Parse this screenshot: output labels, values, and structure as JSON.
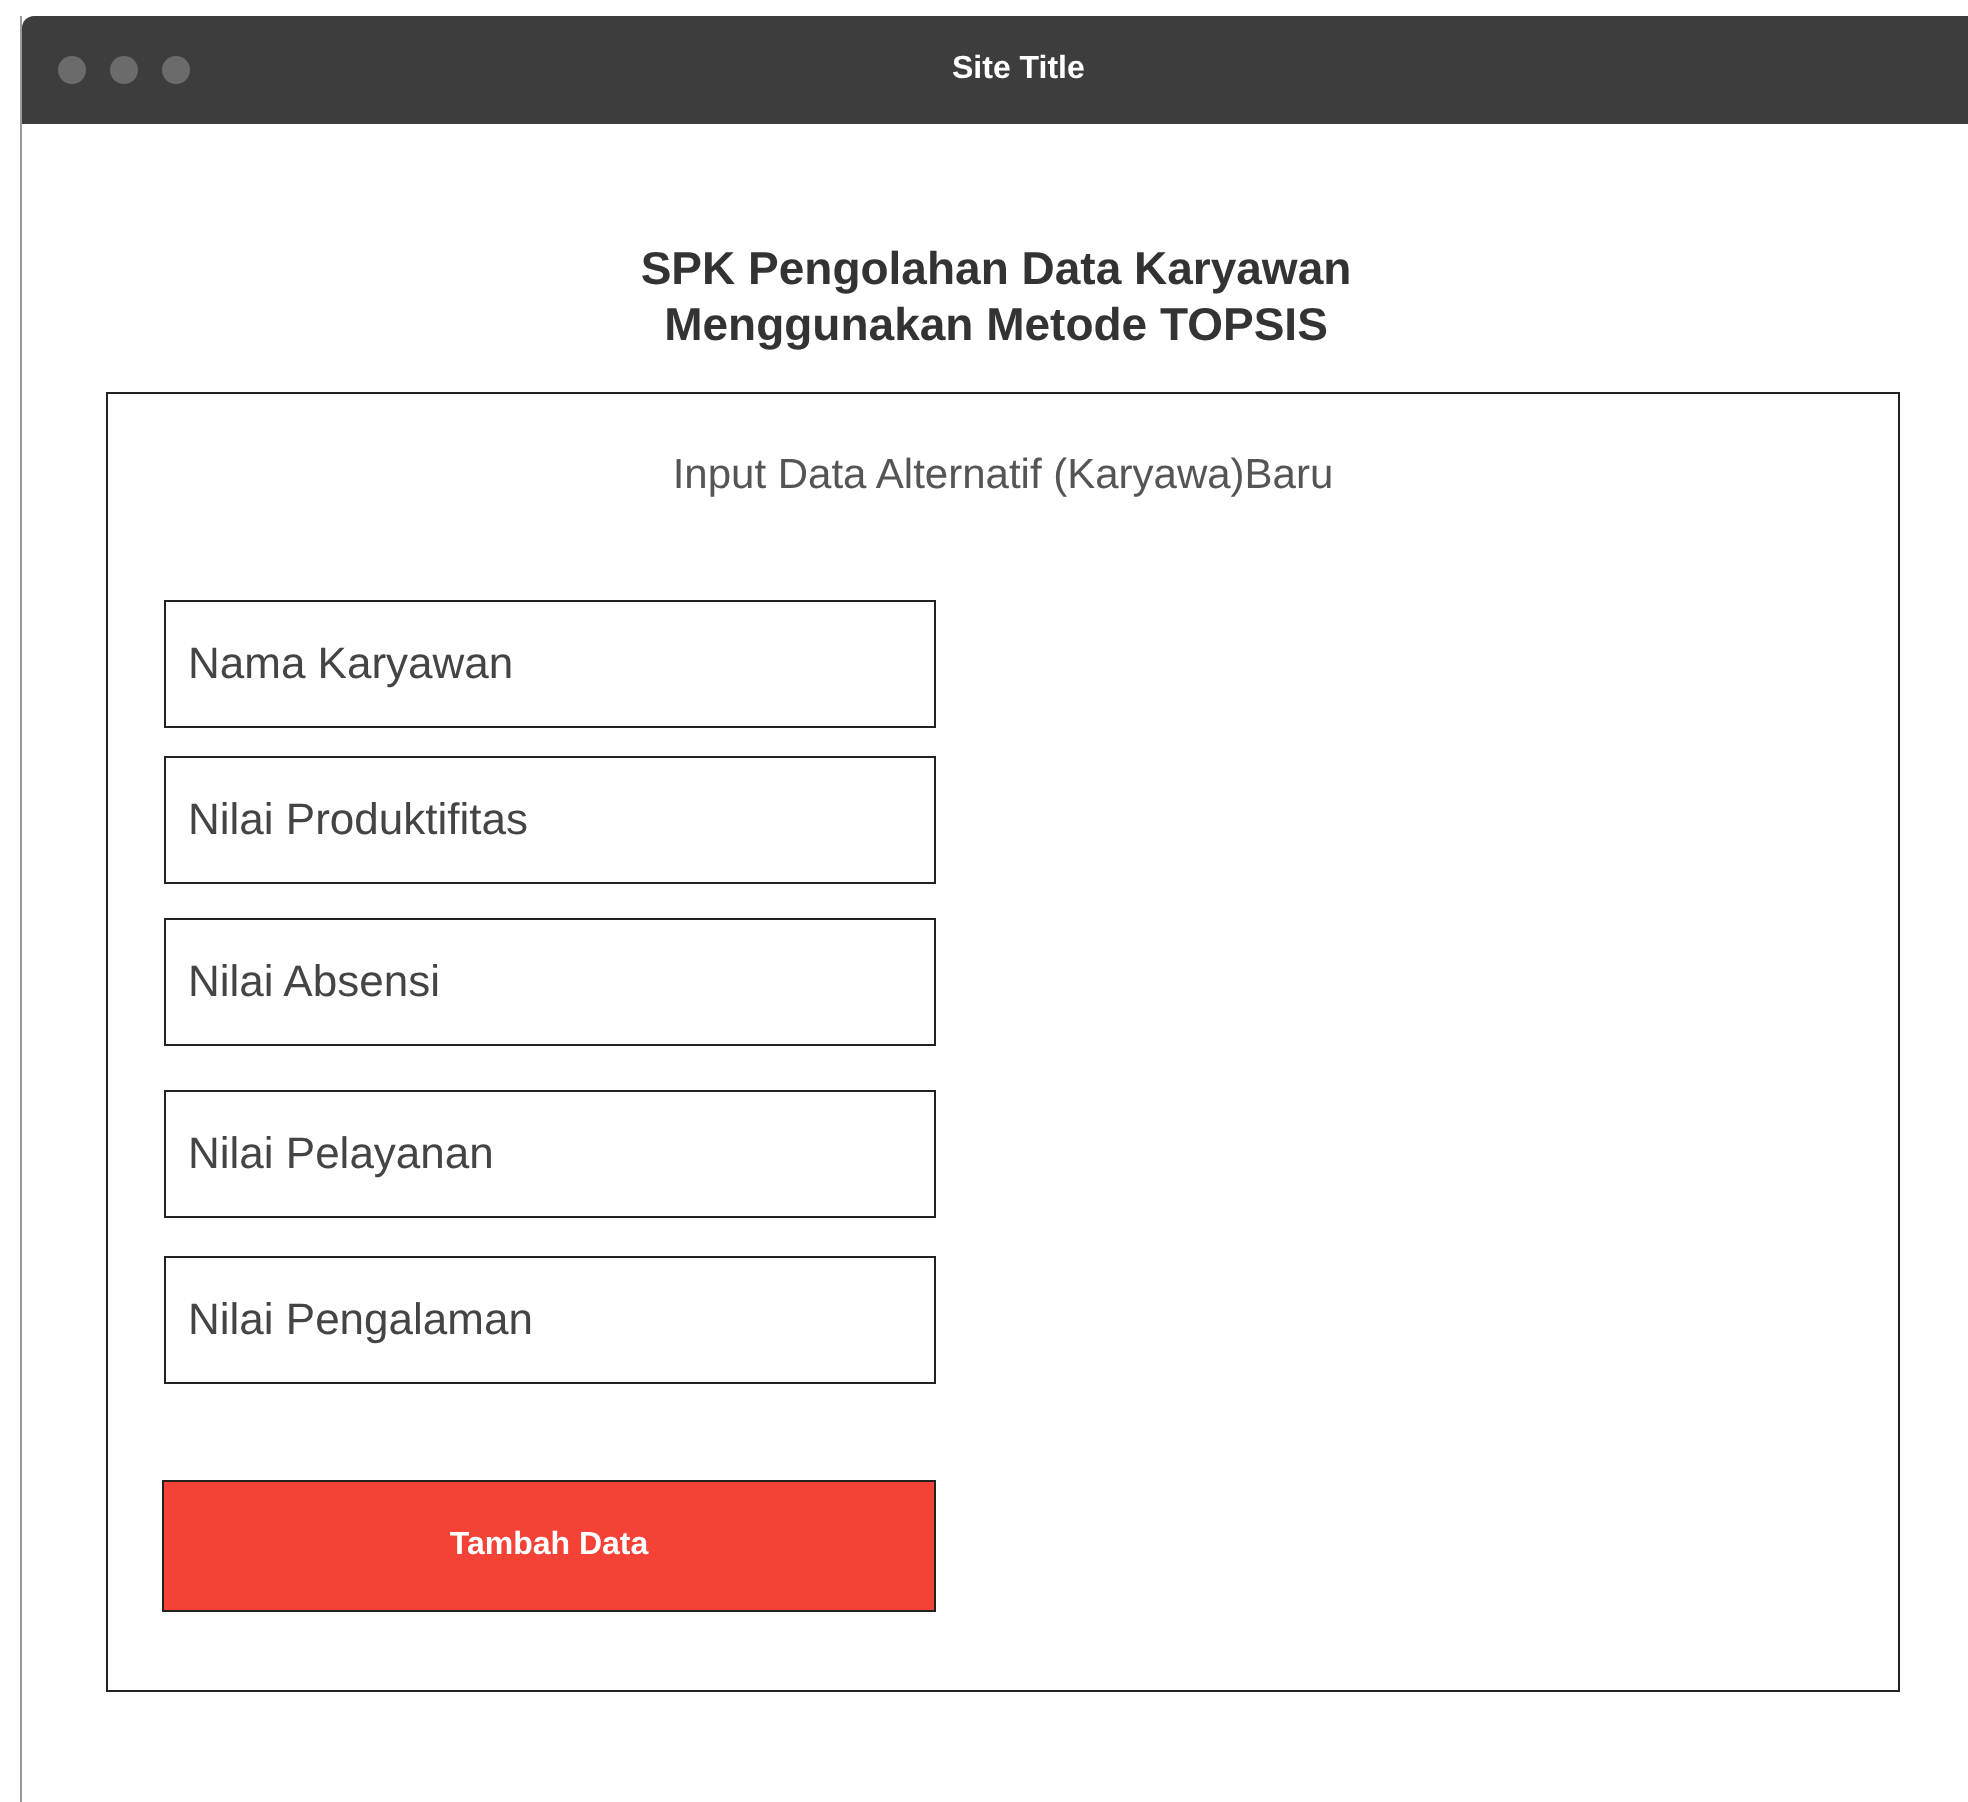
{
  "window": {
    "title": "Site Title"
  },
  "heading": [
    "SPK Pengolahan Data Karyawan",
    "Menggunakan Metode TOPSIS"
  ],
  "form": {
    "title": "Input Data Alternatif (Karyawa)Baru",
    "fields": [
      {
        "placeholder": "Nama Karyawan"
      },
      {
        "placeholder": "Nilai Produktifitas"
      },
      {
        "placeholder": "Nilai Absensi"
      },
      {
        "placeholder": "Nilai Pelayanan"
      },
      {
        "placeholder": "Nilai Pengalaman"
      }
    ],
    "submit": "Tambah Data"
  }
}
